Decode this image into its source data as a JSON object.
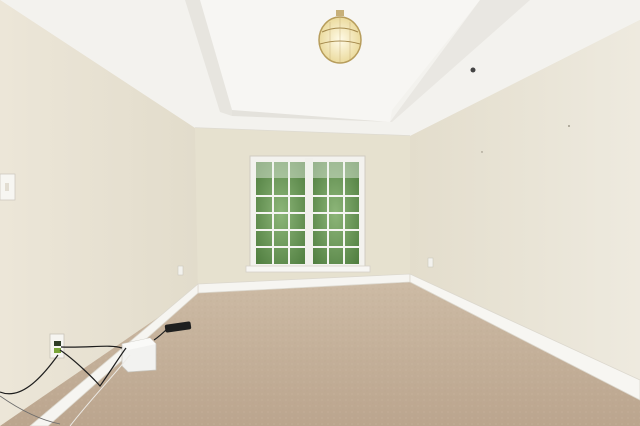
{
  "scene": {
    "subject": "empty-bedroom-interior",
    "palette": {
      "wall_left": "#e8e2d3",
      "wall_back": "#e6e1cf",
      "wall_right": "#e9e4d6",
      "ceiling": "#f4f3ef",
      "carpet": "#c6b29b",
      "trim": "#f6f5f1",
      "window_glass": "#6f9a5a",
      "light_fixture": "#f0e4b0"
    },
    "objects": [
      "tray-ceiling",
      "ceiling-light",
      "double-window",
      "light-switch",
      "wall-outlet",
      "baseboard",
      "carpet-floor",
      "router-device",
      "power-cables"
    ]
  }
}
